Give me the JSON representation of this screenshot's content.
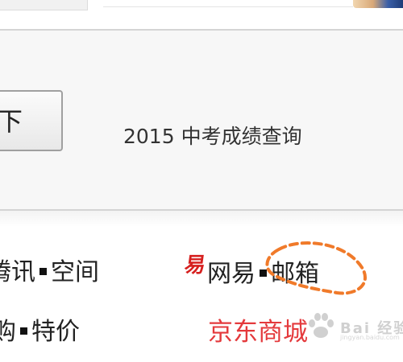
{
  "search": {
    "button_label": "下"
  },
  "exam_link": "2015 中考成绩查询",
  "links": {
    "row1_left_a": "腾讯",
    "row1_left_b": "空间",
    "row2_left_a": "购",
    "row2_left_b": "特价",
    "netease_icon_glyph": "易",
    "netease_label": "网易",
    "mail_label": "邮箱",
    "jd_label": "京东商城"
  },
  "annotation": {
    "color": "#f07a2a",
    "style": "dashed-ellipse"
  },
  "watermark": {
    "text": "Bai 经验",
    "sub": "jingyan.baidu.com"
  },
  "colors": {
    "netease_red": "#d6201f",
    "jd_red": "#e4393c"
  }
}
